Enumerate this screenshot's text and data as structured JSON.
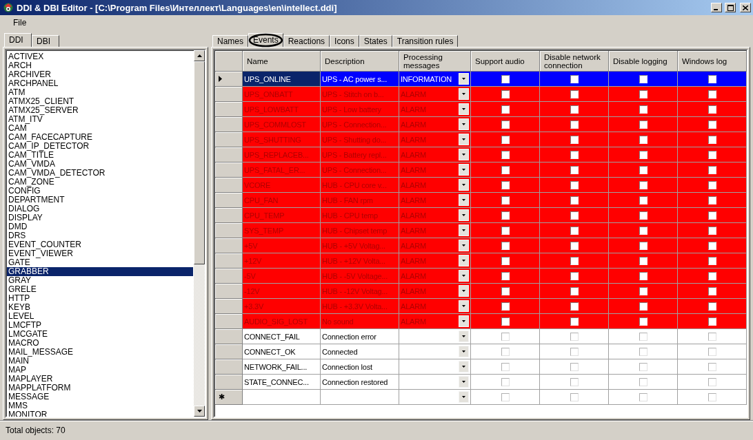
{
  "window": {
    "title": "DDI & DBI Editor - [C:\\Program Files\\Интеллект\\Languages\\en\\intellect.ddi]"
  },
  "menu": [
    "File"
  ],
  "left_tabs": [
    {
      "label": "DDI",
      "selected": true
    },
    {
      "label": "DBI",
      "selected": false
    }
  ],
  "objects": [
    {
      "label": "ACTIVEX",
      "selected": false
    },
    {
      "label": "ARCH",
      "selected": false
    },
    {
      "label": "ARCHIVER",
      "selected": false
    },
    {
      "label": "ARCHPANEL",
      "selected": false
    },
    {
      "label": "ATM",
      "selected": false
    },
    {
      "label": "ATMX25_CLIENT",
      "selected": false
    },
    {
      "label": "ATMX25_SERVER",
      "selected": false
    },
    {
      "label": "ATM_ITV",
      "selected": false
    },
    {
      "label": "CAM",
      "selected": false
    },
    {
      "label": "CAM_FACECAPTURE",
      "selected": false
    },
    {
      "label": "CAM_IP_DETECTOR",
      "selected": false
    },
    {
      "label": "CAM_TITLE",
      "selected": false
    },
    {
      "label": "CAM_VMDA",
      "selected": false
    },
    {
      "label": "CAM_VMDA_DETECTOR",
      "selected": false
    },
    {
      "label": "CAM_ZONE",
      "selected": false
    },
    {
      "label": "CONFIG",
      "selected": false
    },
    {
      "label": "DEPARTMENT",
      "selected": false
    },
    {
      "label": "DIALOG",
      "selected": false
    },
    {
      "label": "DISPLAY",
      "selected": false
    },
    {
      "label": "DMD",
      "selected": false
    },
    {
      "label": "DRS",
      "selected": false
    },
    {
      "label": "EVENT_COUNTER",
      "selected": false
    },
    {
      "label": "EVENT_VIEWER",
      "selected": false
    },
    {
      "label": "GATE",
      "selected": false
    },
    {
      "label": "GRABBER",
      "selected": true
    },
    {
      "label": "GRAY",
      "selected": false
    },
    {
      "label": "GRELE",
      "selected": false
    },
    {
      "label": "HTTP",
      "selected": false
    },
    {
      "label": "KEYB",
      "selected": false
    },
    {
      "label": "LEVEL",
      "selected": false
    },
    {
      "label": "LMCFTP",
      "selected": false
    },
    {
      "label": "LMCGATE",
      "selected": false
    },
    {
      "label": "MACRO",
      "selected": false
    },
    {
      "label": "MAIL_MESSAGE",
      "selected": false
    },
    {
      "label": "MAIN",
      "selected": false
    },
    {
      "label": "MAP",
      "selected": false
    },
    {
      "label": "MAPLAYER",
      "selected": false
    },
    {
      "label": "MAPPLATFORM",
      "selected": false
    },
    {
      "label": "MESSAGE",
      "selected": false
    },
    {
      "label": "MMS",
      "selected": false
    },
    {
      "label": "MONITOR",
      "selected": false
    }
  ],
  "status_bar": "Total objects: 70",
  "tabs": [
    {
      "label": "Names",
      "selected": false,
      "circled": false
    },
    {
      "label": "Events",
      "selected": true,
      "circled": true
    },
    {
      "label": "Reactions",
      "selected": false,
      "circled": false
    },
    {
      "label": "Icons",
      "selected": false,
      "circled": false
    },
    {
      "label": "States",
      "selected": false,
      "circled": false
    },
    {
      "label": "Transition rules",
      "selected": false,
      "circled": false
    }
  ],
  "table": {
    "columns": [
      "Name",
      "Description",
      "Processing messages",
      "Support audio",
      "Disable network connection",
      "Disable logging",
      "Windows log"
    ],
    "rows": [
      {
        "kind": "event",
        "selected": true,
        "color": "#0000ff",
        "name": "UPS_ONLINE",
        "description": "UPS - AC power s...",
        "processing": "INFORMATION",
        "checks": [
          false,
          false,
          false,
          false
        ]
      },
      {
        "kind": "event",
        "selected": false,
        "color": "#ff0000",
        "name": "UPS_ONBATT",
        "description": "UPS - Stitch on b...",
        "processing": "ALARM",
        "checks": [
          false,
          false,
          false,
          false
        ]
      },
      {
        "kind": "event",
        "selected": false,
        "color": "#ff0000",
        "name": "UPS_LOWBATT",
        "description": "UPS - Low battery",
        "processing": "ALARM",
        "checks": [
          false,
          false,
          false,
          false
        ]
      },
      {
        "kind": "event",
        "selected": false,
        "color": "#ff0000",
        "name": "UPS_COMMLOST",
        "description": "UPS - Connection...",
        "processing": "ALARM",
        "checks": [
          false,
          false,
          false,
          false
        ]
      },
      {
        "kind": "event",
        "selected": false,
        "color": "#ff0000",
        "name": "UPS_SHUTTING",
        "description": "UPS - Shutting do...",
        "processing": "ALARM",
        "checks": [
          false,
          false,
          false,
          false
        ]
      },
      {
        "kind": "event",
        "selected": false,
        "color": "#ff0000",
        "name": "UPS_REPLACEB...",
        "description": "UPS - Battery repl...",
        "processing": "ALARM",
        "checks": [
          false,
          false,
          false,
          false
        ]
      },
      {
        "kind": "event",
        "selected": false,
        "color": "#ff0000",
        "name": "UPS_FATAL_ER...",
        "description": "UPS - Connection...",
        "processing": "ALARM",
        "checks": [
          false,
          false,
          false,
          false
        ]
      },
      {
        "kind": "event",
        "selected": false,
        "color": "#ff0000",
        "name": "VCORE",
        "description": "HUB - CPU core v...",
        "processing": "ALARM",
        "checks": [
          false,
          false,
          false,
          false
        ]
      },
      {
        "kind": "event",
        "selected": false,
        "color": "#ff0000",
        "name": "CPU_FAN",
        "description": "HUB - FAN rpm",
        "processing": "ALARM",
        "checks": [
          false,
          false,
          false,
          false
        ]
      },
      {
        "kind": "event",
        "selected": false,
        "color": "#ff0000",
        "name": "CPU_TEMP",
        "description": "HUB - CPU temp",
        "processing": "ALARM",
        "checks": [
          false,
          false,
          false,
          false
        ]
      },
      {
        "kind": "event",
        "selected": false,
        "color": "#ff0000",
        "name": "SYS_TEMP",
        "description": "HUB - Chipset temp",
        "processing": "ALARM",
        "checks": [
          false,
          false,
          false,
          false
        ]
      },
      {
        "kind": "event",
        "selected": false,
        "color": "#ff0000",
        "name": "+5V",
        "description": "HUB - +5V Voltag...",
        "processing": "ALARM",
        "checks": [
          false,
          false,
          false,
          false
        ]
      },
      {
        "kind": "event",
        "selected": false,
        "color": "#ff0000",
        "name": "+12V",
        "description": "HUB - +12V Volta...",
        "processing": "ALARM",
        "checks": [
          false,
          false,
          false,
          false
        ]
      },
      {
        "kind": "event",
        "selected": false,
        "color": "#ff0000",
        "name": "-5V",
        "description": "HUB - -5V Voltage...",
        "processing": "ALARM",
        "checks": [
          false,
          false,
          false,
          false
        ]
      },
      {
        "kind": "event",
        "selected": false,
        "color": "#ff0000",
        "name": "-12V",
        "description": "HUB - -12V Voltag...",
        "processing": "ALARM",
        "checks": [
          false,
          false,
          false,
          false
        ]
      },
      {
        "kind": "event",
        "selected": false,
        "color": "#ff0000",
        "name": "+3.3V",
        "description": "HUB - +3.3V Volta...",
        "processing": "ALARM",
        "checks": [
          false,
          false,
          false,
          false
        ]
      },
      {
        "kind": "event",
        "selected": false,
        "color": "#ff0000",
        "name": "AUDIO_SIG_LOST",
        "description": "No sound",
        "processing": "ALARM",
        "checks": [
          false,
          false,
          false,
          false
        ]
      },
      {
        "kind": "event",
        "selected": false,
        "color": "#ffffff",
        "name": "CONNECT_FAIL",
        "description": "Connection error",
        "checks": [
          false,
          false,
          false,
          false
        ]
      },
      {
        "kind": "event",
        "selected": false,
        "color": "#ffffff",
        "name": "CONNECT_OK",
        "description": "Connected",
        "checks": [
          false,
          false,
          false,
          false
        ]
      },
      {
        "kind": "event",
        "selected": false,
        "color": "#ffffff",
        "name": "NETWORK_FAIL...",
        "description": "Connection lost",
        "checks": [
          false,
          false,
          false,
          false
        ]
      },
      {
        "kind": "event",
        "selected": false,
        "color": "#ffffff",
        "name": "STATE_CONNEC...",
        "description": "Connection restored",
        "checks": [
          false,
          false,
          false,
          false
        ]
      },
      {
        "kind": "new",
        "selected": false,
        "color": "#ffffff",
        "marker": "✱",
        "checks": [
          false,
          false,
          false,
          false
        ]
      }
    ]
  }
}
